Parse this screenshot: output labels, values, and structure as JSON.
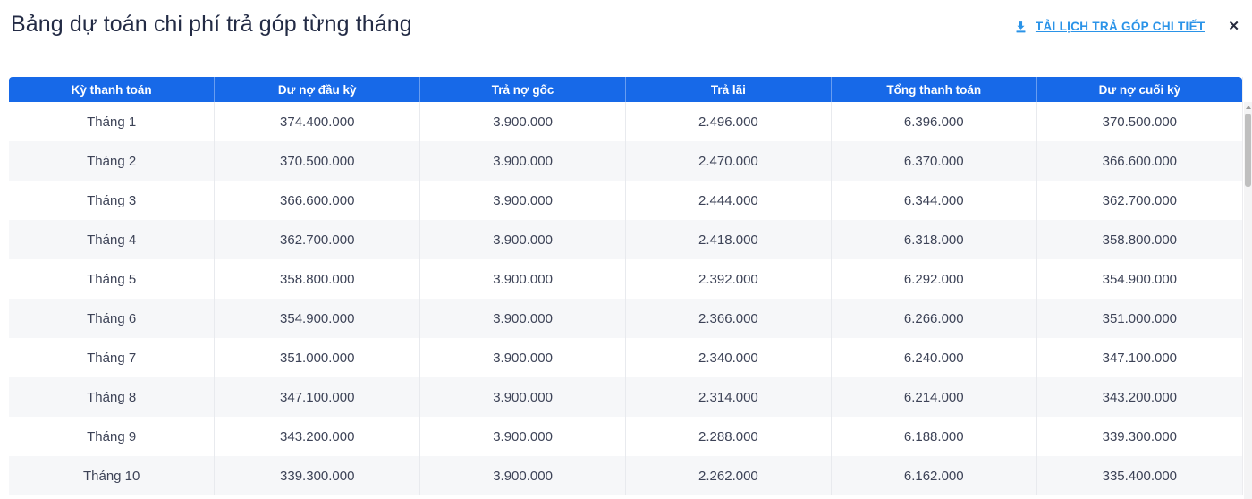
{
  "header": {
    "title": "Bảng dự toán chi phí trả góp từng tháng",
    "download_label": "TẢI LỊCH TRẢ GÓP CHI TIẾT",
    "close_label": "✕"
  },
  "table": {
    "columns": [
      "Kỳ thanh toán",
      "Dư nợ đầu kỳ",
      "Trả nợ gốc",
      "Trả lãi",
      "Tổng thanh toán",
      "Dư nợ cuối kỳ"
    ],
    "rows": [
      [
        "Tháng 1",
        "374.400.000",
        "3.900.000",
        "2.496.000",
        "6.396.000",
        "370.500.000"
      ],
      [
        "Tháng 2",
        "370.500.000",
        "3.900.000",
        "2.470.000",
        "6.370.000",
        "366.600.000"
      ],
      [
        "Tháng 3",
        "366.600.000",
        "3.900.000",
        "2.444.000",
        "6.344.000",
        "362.700.000"
      ],
      [
        "Tháng 4",
        "362.700.000",
        "3.900.000",
        "2.418.000",
        "6.318.000",
        "358.800.000"
      ],
      [
        "Tháng 5",
        "358.800.000",
        "3.900.000",
        "2.392.000",
        "6.292.000",
        "354.900.000"
      ],
      [
        "Tháng 6",
        "354.900.000",
        "3.900.000",
        "2.366.000",
        "6.266.000",
        "351.000.000"
      ],
      [
        "Tháng 7",
        "351.000.000",
        "3.900.000",
        "2.340.000",
        "6.240.000",
        "347.100.000"
      ],
      [
        "Tháng 8",
        "347.100.000",
        "3.900.000",
        "2.314.000",
        "6.214.000",
        "343.200.000"
      ],
      [
        "Tháng 9",
        "343.200.000",
        "3.900.000",
        "2.288.000",
        "6.188.000",
        "339.300.000"
      ],
      [
        "Tháng 10",
        "339.300.000",
        "3.900.000",
        "2.262.000",
        "6.162.000",
        "335.400.000"
      ]
    ]
  },
  "colors": {
    "header_bg": "#1769e8",
    "link_blue": "#2a93e8",
    "alt_row_bg": "#f6f7f9",
    "title_color": "#232b45",
    "cell_text": "#3d4357",
    "cell_divider": "#e8eaee"
  }
}
